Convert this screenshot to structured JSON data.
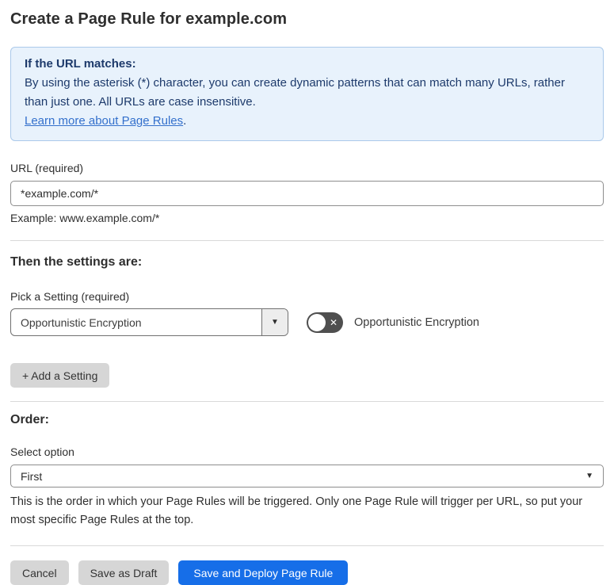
{
  "page": {
    "title": "Create a Page Rule for example.com"
  },
  "info_box": {
    "title": "If the URL matches:",
    "body": "By using the asterisk (*) character, you can create dynamic patterns that can match many URLs, rather than just one. All URLs are case insensitive.",
    "link_text": "Learn more about Page Rules",
    "link_suffix": "."
  },
  "url_field": {
    "label": "URL (required)",
    "value": "*example.com/*",
    "hint": "Example: www.example.com/*"
  },
  "settings_section": {
    "heading": "Then the settings are:",
    "picker_label": "Pick a Setting (required)",
    "selected_setting": "Opportunistic Encryption",
    "dropdown_caret_glyph": "▼",
    "toggle": {
      "state": "off",
      "off_glyph": "✕",
      "label": "Opportunistic Encryption"
    },
    "add_button_label": "+ Add a Setting"
  },
  "order_section": {
    "heading": "Order:",
    "select_label": "Select option",
    "selected_option": "First",
    "select_caret_glyph": "▼",
    "hint": "This is the order in which your Page Rules will be triggered. Only one Page Rule will trigger per URL, so put your most specific Page Rules at the top."
  },
  "actions": {
    "cancel_label": "Cancel",
    "save_draft_label": "Save as Draft",
    "save_deploy_label": "Save and Deploy Page Rule"
  },
  "colors": {
    "info_box_bg": "#e8f2fc",
    "info_box_border": "#abc9ea",
    "info_box_text": "#1d3a6b",
    "link_blue": "#3370cc",
    "primary_button_blue": "#166ee8",
    "toggle_off_bg": "#4f4f4f",
    "gray_button_bg": "#d6d6d6"
  }
}
